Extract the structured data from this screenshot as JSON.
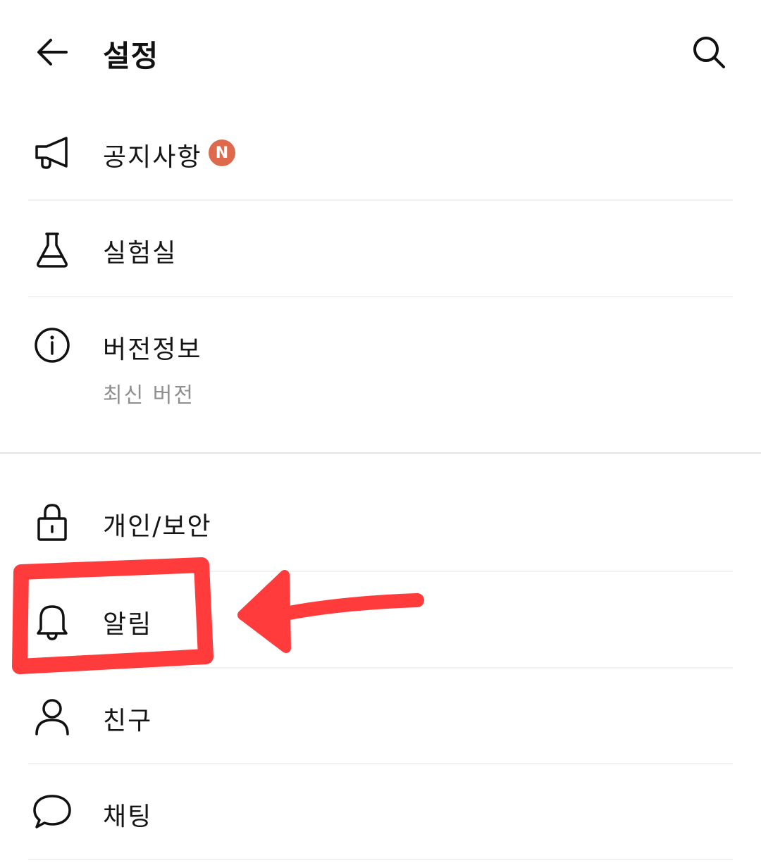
{
  "header": {
    "title": "설정",
    "back_icon": "arrow-left-icon",
    "search_icon": "search-icon"
  },
  "menu": {
    "notice": {
      "label": "공지사항",
      "icon": "megaphone-icon",
      "badge": "N",
      "badge_color": "#dd6a4d"
    },
    "lab": {
      "label": "실험실",
      "icon": "flask-icon"
    },
    "version": {
      "label": "버전정보",
      "sublabel": "최신 버전",
      "icon": "info-icon"
    },
    "privacy": {
      "label": "개인/보안",
      "icon": "lock-icon"
    },
    "notifications": {
      "label": "알림",
      "icon": "bell-icon"
    },
    "friends": {
      "label": "친구",
      "icon": "person-icon"
    },
    "chat": {
      "label": "채팅",
      "icon": "chat-bubble-icon"
    }
  },
  "annotation": {
    "color": "#ff3b3b",
    "highlight": "notifications"
  }
}
